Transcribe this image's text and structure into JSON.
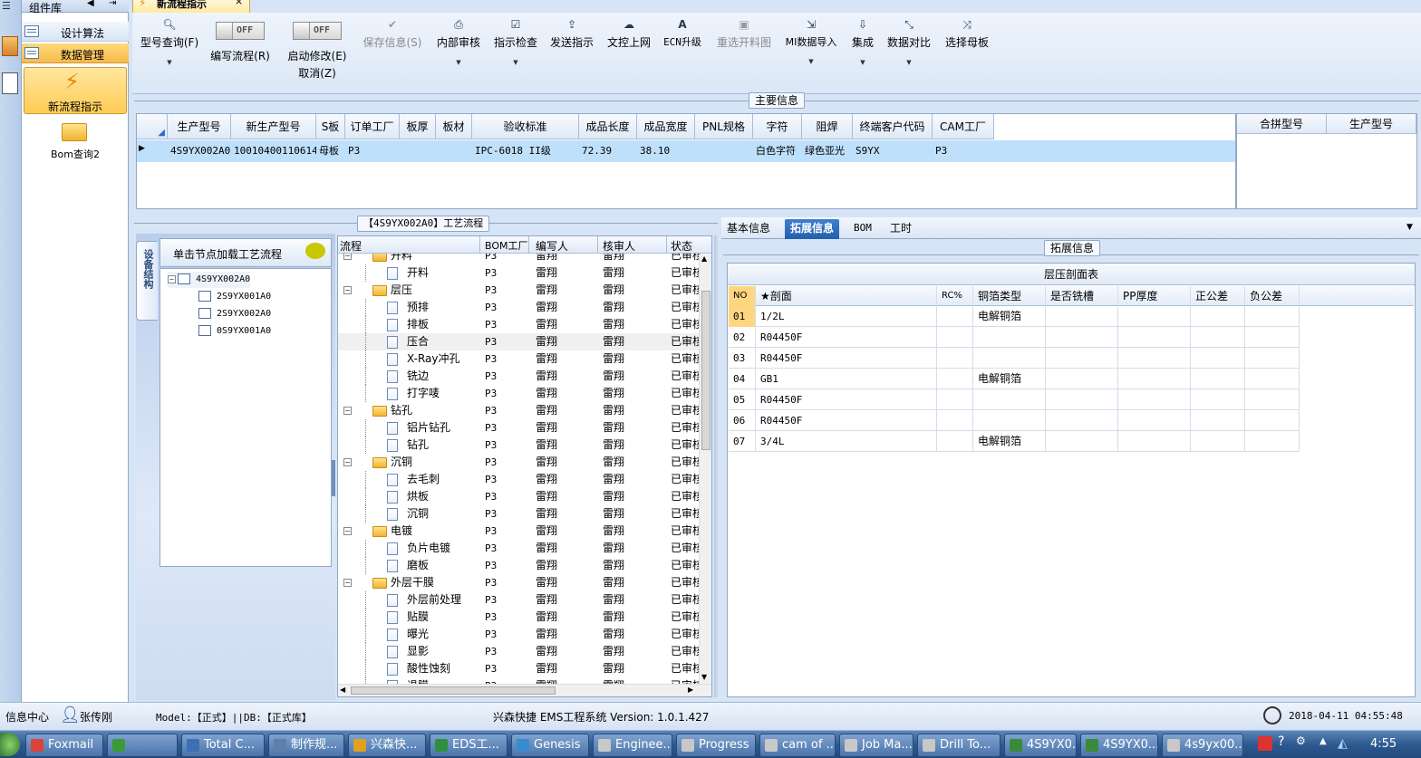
{
  "sidebar": {
    "title": "组件库",
    "items": [
      "设计算法",
      "数据管理"
    ],
    "big_button": "新流程指示",
    "bom_button": "Bom查询2"
  },
  "doc_tab": {
    "label": "新流程指示",
    "close": "×"
  },
  "toolbar": {
    "btn_model_query": "型号查询(F)",
    "btn_edit_flow": "编写流程(R)",
    "toggle_off": "OFF",
    "btn_start_edit": "启动修改(E)",
    "btn_cancel": "取消(Z)",
    "btn_save": "保存信息(S)",
    "btn_internal": "内部审核",
    "btn_check": "指示检查",
    "btn_send": "发送指示",
    "btn_upload": "文控上网",
    "btn_ecn": "ECN升级",
    "btn_reselect": "重选开料图",
    "btn_mi": "MI数据导入",
    "btn_integrate": "集成",
    "btn_compare": "数据对比",
    "btn_select_master": "选择母板"
  },
  "main_info": {
    "title": "主要信息",
    "columns": [
      "生产型号",
      "新生产型号",
      "S板",
      "订单工厂",
      "板厚",
      "板材",
      "验收标准",
      "成品长度",
      "成品宽度",
      "PNL规格",
      "字符",
      "阻焊",
      "终端客户代码",
      "CAM工厂"
    ],
    "row": [
      "4S9YX002A0",
      "10010400110614",
      "母板",
      "P3",
      "",
      "",
      "IPC-6018 II级",
      "72.39",
      "38.10",
      "",
      "白色字符",
      "绿色亚光",
      "S9YX",
      "P3"
    ],
    "side_columns": [
      "合拼型号",
      "生产型号"
    ]
  },
  "flow_panel": {
    "title": "【4S9YX002A0】工艺流程",
    "vtab": "设备结构",
    "tree_header": "单击节点加载工艺流程",
    "tree_root": "4S9YX002A0",
    "tree_children": [
      "2S9YX001A0",
      "2S9YX002A0",
      "0S9YX001A0"
    ],
    "columns": [
      "流程",
      "BOM工厂",
      "编写人",
      "核审人",
      "状态"
    ],
    "rows": [
      {
        "name": "开料",
        "lvl": 0,
        "folder": 1
      },
      {
        "name": "开料",
        "lvl": 1,
        "folder": 0
      },
      {
        "name": "层压",
        "lvl": 0,
        "folder": 1
      },
      {
        "name": "预排",
        "lvl": 1,
        "folder": 0
      },
      {
        "name": "排板",
        "lvl": 1,
        "folder": 0
      },
      {
        "name": "压合",
        "lvl": 1,
        "folder": 0
      },
      {
        "name": "X-Ray冲孔",
        "lvl": 1,
        "folder": 0
      },
      {
        "name": "铣边",
        "lvl": 1,
        "folder": 0
      },
      {
        "name": "打字唛",
        "lvl": 1,
        "folder": 0
      },
      {
        "name": "钻孔",
        "lvl": 0,
        "folder": 1
      },
      {
        "name": "铝片钻孔",
        "lvl": 1,
        "folder": 0
      },
      {
        "name": "钻孔",
        "lvl": 1,
        "folder": 0
      },
      {
        "name": "沉铜",
        "lvl": 0,
        "folder": 1
      },
      {
        "name": "去毛刺",
        "lvl": 1,
        "folder": 0
      },
      {
        "name": "烘板",
        "lvl": 1,
        "folder": 0
      },
      {
        "name": "沉铜",
        "lvl": 1,
        "folder": 0
      },
      {
        "name": "电镀",
        "lvl": 0,
        "folder": 1
      },
      {
        "name": "负片电镀",
        "lvl": 1,
        "folder": 0
      },
      {
        "name": "磨板",
        "lvl": 1,
        "folder": 0
      },
      {
        "name": "外层干膜",
        "lvl": 0,
        "folder": 1
      },
      {
        "name": "外层前处理",
        "lvl": 1,
        "folder": 0
      },
      {
        "name": "贴膜",
        "lvl": 1,
        "folder": 0
      },
      {
        "name": "曝光",
        "lvl": 1,
        "folder": 0
      },
      {
        "name": "显影",
        "lvl": 1,
        "folder": 0
      },
      {
        "name": "酸性蚀刻",
        "lvl": 1,
        "folder": 0
      },
      {
        "name": "退膜",
        "lvl": 1,
        "folder": 0
      }
    ],
    "bom_factory": "P3",
    "writer": "雷翔",
    "reviewer": "雷翔",
    "status": "已审核"
  },
  "right_panel": {
    "tabs": [
      "基本信息",
      "拓展信息",
      "BOM",
      "工时"
    ],
    "active_tab": "拓展信息",
    "section_title": "拓展信息",
    "table_title": "层压剖面表",
    "columns": [
      "NO",
      "★剖面",
      "RC%",
      "铜箔类型",
      "是否铣槽",
      "PP厚度",
      "正公差",
      "负公差"
    ],
    "rows": [
      {
        "no": "01",
        "section": "1/2L",
        "foil": "电解铜箔"
      },
      {
        "no": "02",
        "section": "R04450F",
        "foil": ""
      },
      {
        "no": "03",
        "section": "R04450F",
        "foil": ""
      },
      {
        "no": "04",
        "section": "GB1",
        "foil": "电解铜箔"
      },
      {
        "no": "05",
        "section": "R04450F",
        "foil": ""
      },
      {
        "no": "06",
        "section": "R04450F",
        "foil": ""
      },
      {
        "no": "07",
        "section": "3/4L",
        "foil": "电解铜箔"
      }
    ]
  },
  "status_bar": {
    "info_center": "信息中心",
    "user": "张传刚",
    "model_db": "Model:【正式】||DB:【正式库】",
    "system": "兴森快捷 EMS工程系统 Version: 1.0.1.427",
    "datetime": "2018-04-11 04:55:48"
  },
  "taskbar": {
    "items": [
      "Foxmail",
      "",
      "Total C...",
      "制作规...",
      "兴森快...",
      "EDS工...",
      "Genesis",
      "Enginee...",
      "Progress",
      "cam of ...",
      "Job Ma...",
      "Drill To...",
      "4S9YX0...",
      "4S9YX0...",
      "4s9yx00..."
    ],
    "time": "4:55",
    "colors": [
      "#d9443a",
      "#3a9a3a",
      "#3d6fb5",
      "#5f7fa8",
      "#e0a020",
      "#2f8f3f",
      "#3a8ad0",
      "#c8c8c8",
      "#c8c8c8",
      "#c8c8c8",
      "#c8c8c8",
      "#c8c8c8",
      "#3a8a3a",
      "#3a8a3a",
      "#c8c8c8"
    ]
  }
}
